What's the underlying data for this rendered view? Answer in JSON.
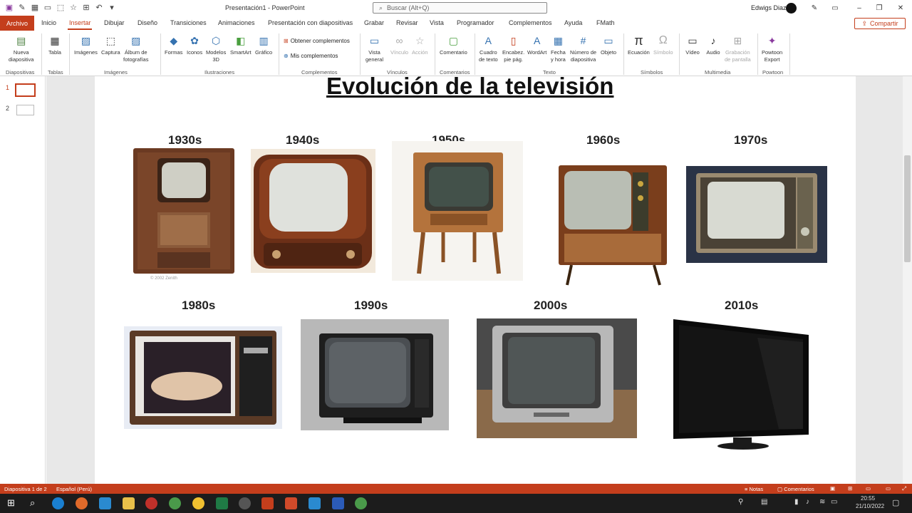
{
  "window": {
    "title": "Presentación1  -  PowerPoint",
    "search_placeholder": "Buscar (Alt+Q)",
    "user": "Edwigs Diaz"
  },
  "tabs": {
    "file": "Archivo",
    "items": [
      "Inicio",
      "Insertar",
      "Dibujar",
      "Diseño",
      "Transiciones",
      "Animaciones",
      "Presentación con diapositivas",
      "Grabar",
      "Revisar",
      "Vista",
      "Programador",
      "Complementos",
      "Ayuda",
      "FMath"
    ],
    "share": "Compartir"
  },
  "ribbon": {
    "nueva": "Nueva",
    "diapositiva": "diapositiva",
    "tabla": "Tabla",
    "imagenes": "Imágenes",
    "captura": "Captura",
    "album": "Álbum de",
    "fotografias": "fotografías",
    "formas": "Formas",
    "iconos": "Iconos",
    "modelos": "Modelos",
    "modelos3d": "3D",
    "smartart": "SmartArt",
    "grafico": "Gráfico",
    "obtener": "Obtener complementos",
    "mis": "Mis complementos",
    "vista": "Vista",
    "general": "general",
    "vinculo": "Vínculo",
    "accion": "Acción",
    "comentario": "Comentario",
    "cuadro": "Cuadro",
    "detexto": "de texto",
    "encabez": "Encabez.",
    "piepag": "pie pág.",
    "wordart": "WordArt",
    "fecha": "Fecha",
    "yhora": "y hora",
    "numero": "Número de",
    "diapositiva2": "diapositiva",
    "objeto": "Objeto",
    "ecuacion": "Ecuación",
    "simbolo": "Símbolo",
    "video": "Vídeo",
    "audio": "Audio",
    "grabacion": "Grabación",
    "depantalla": "de pantalla",
    "powtoon": "Powtoon",
    "export": "Export",
    "groups": {
      "diapositivas": "Diapositivas",
      "tablas": "Tablas",
      "imagenes": "Imágenes",
      "ilustraciones": "Ilustraciones",
      "complementos": "Complementos",
      "vinculos": "Vínculos",
      "comentarios": "Comentarios",
      "texto": "Texto",
      "simbolos": "Símbolos",
      "multimedia": "Multimedia",
      "powtoon": "Powtoon"
    }
  },
  "slides": {
    "n1": "1",
    "n2": "2"
  },
  "slide": {
    "title": "Evolución de la televisión",
    "decades": [
      "1930s",
      "1940s",
      "1950s",
      "1960s",
      "1970s",
      "1980s",
      "1990s",
      "2000s",
      "2010s"
    ],
    "watermark": "© 2002 Zenith"
  },
  "status": {
    "slide": "Diapositiva 1 de 2",
    "lang": "Español (Perú)",
    "notes": "Notas",
    "comments": "Comentarios"
  },
  "taskbar": {
    "time": "20:55",
    "date": "21/10/2022"
  },
  "colors": {
    "accent": "#c43e1c"
  }
}
